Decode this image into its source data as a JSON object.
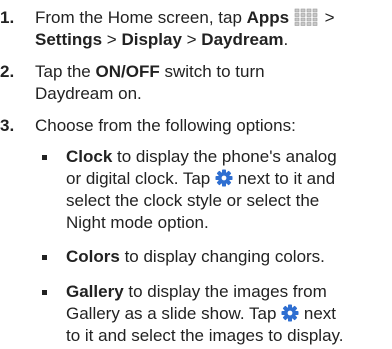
{
  "steps": [
    {
      "number": "1.",
      "line1_pre": "From the Home screen, tap ",
      "apps": "Apps",
      "line1_post": " >",
      "settings": "Settings",
      "sep1": " > ",
      "display": "Display",
      "sep2": " > ",
      "daydream": "Daydream",
      "end": "."
    },
    {
      "number": "2.",
      "line1_pre": "Tap the ",
      "onoff": "ON/OFF",
      "line1_post": " switch to turn",
      "line2": "Daydream on."
    },
    {
      "number": "3.",
      "text": "Choose from the following options:"
    }
  ],
  "options": [
    {
      "name": "Clock",
      "line1": " to display the phone's analog",
      "line2_pre": "or digital clock. Tap ",
      "line2_post": " next to it and",
      "line3": "select the clock style or select the",
      "line4": "Night mode option."
    },
    {
      "name": "Colors",
      "line1": " to display changing colors."
    },
    {
      "name": "Gallery",
      "line1": " to display the images from",
      "line2_pre": "Gallery as a slide show. Tap ",
      "line2_post": " next",
      "line3": "to it and select the images to display."
    }
  ],
  "icons": {
    "apps": "apps-grid-icon",
    "settings": "settings-gear-icon"
  },
  "colors": {
    "text": "#222222",
    "icon_blue": "#2f6fd1"
  }
}
